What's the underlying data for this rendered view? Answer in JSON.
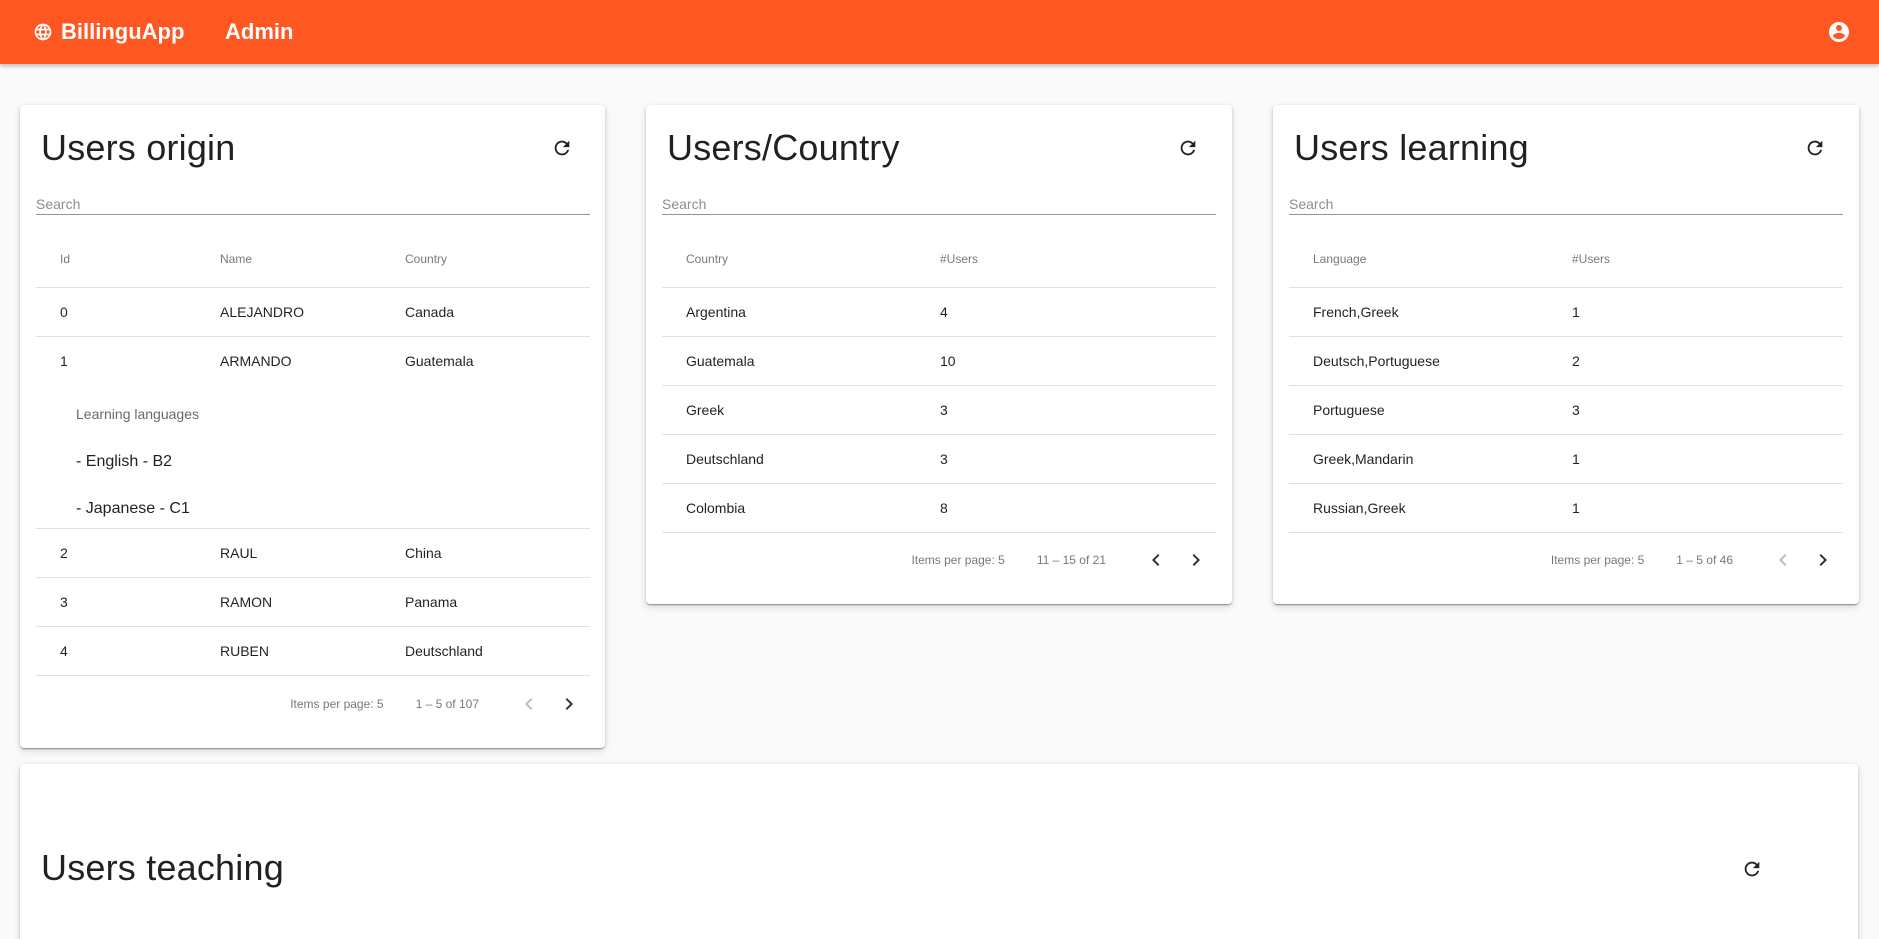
{
  "app": {
    "brand": "BillinguApp",
    "admin": "Admin"
  },
  "icons": {
    "brand": "globe-icon",
    "account": "account-circle-icon",
    "refresh": "refresh-icon",
    "prev": "chevron-left-icon",
    "next": "chevron-right-icon"
  },
  "colors": {
    "toolbar": "#ff5722"
  },
  "origin": {
    "title": "Users origin",
    "search_placeholder": "Search",
    "headers": [
      "Id",
      "Name",
      "Country"
    ],
    "rows": [
      [
        "0",
        "ALEJANDRO",
        "Canada"
      ],
      [
        "1",
        "ARMANDO",
        "Guatemala"
      ],
      [
        "2",
        "RAUL",
        "China"
      ],
      [
        "3",
        "RAMON",
        "Panama"
      ],
      [
        "4",
        "RUBEN",
        "Deutschland"
      ]
    ],
    "detail": {
      "label": "Learning languages",
      "languages": [
        "- English - B2",
        "- Japanese - C1"
      ]
    },
    "paginator": {
      "items_per_page": "Items per page: 5",
      "range": "1 – 5 of 107"
    }
  },
  "country": {
    "title": "Users/Country",
    "search_placeholder": "Search",
    "headers": [
      "Country",
      "#Users"
    ],
    "rows": [
      [
        "Argentina",
        "4"
      ],
      [
        "Guatemala",
        "10"
      ],
      [
        "Greek",
        "3"
      ],
      [
        "Deutschland",
        "3"
      ],
      [
        "Colombia",
        "8"
      ]
    ],
    "paginator": {
      "items_per_page": "Items per page: 5",
      "range": "11 – 15 of 21"
    }
  },
  "learning": {
    "title": "Users learning",
    "search_placeholder": "Search",
    "headers": [
      "Language",
      "#Users"
    ],
    "rows": [
      [
        "French,Greek",
        "1"
      ],
      [
        "Deutsch,Portuguese",
        "2"
      ],
      [
        "Portuguese",
        "3"
      ],
      [
        "Greek,Mandarin",
        "1"
      ],
      [
        "Russian,Greek",
        "1"
      ]
    ],
    "paginator": {
      "items_per_page": "Items per page: 5",
      "range": "1 – 5 of 46"
    }
  },
  "teaching": {
    "title": "Users teaching"
  }
}
